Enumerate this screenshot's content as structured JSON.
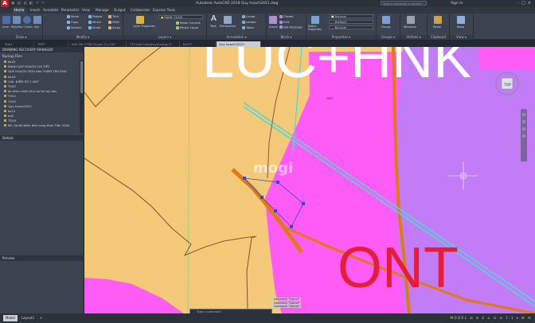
{
  "app": {
    "logo_letter": "A",
    "title": "Autodesk AutoCAD 2018   Quy hoach2021.dwg",
    "search_placeholder": "Type a keyword or phrase",
    "sign_in": "Sign In",
    "quick_access": "▣ ▤ ▥ ◧ ↶ ↷"
  },
  "ribbon_tabs": [
    "Home",
    "Insert",
    "Annotate",
    "Parametric",
    "View",
    "Manage",
    "Output",
    "Collaborate",
    "Express Tools"
  ],
  "ribbon": {
    "draw": {
      "title": "Draw ▾",
      "tools": [
        "Line",
        "Polyline",
        "Circle",
        "Arc"
      ]
    },
    "modify": {
      "title": "Modify ▾",
      "tools": [
        "Move",
        "Rotate",
        "Trim",
        "Copy",
        "Mirror",
        "Fillet",
        "Stretch",
        "Scale",
        "Array"
      ]
    },
    "layers": {
      "title": "Layers ▾",
      "layer_properties": "Layer Properties",
      "current_layer": "RANH_CGCN",
      "make_current": "Make Current",
      "match_layer": "Match Layer"
    },
    "annotation": {
      "title": "Annotation ▾",
      "text": "Text",
      "dimension": "Dimension",
      "linear": "Linear",
      "leader": "Leader",
      "table": "Table"
    },
    "block": {
      "title": "Block ▾",
      "insert": "Insert",
      "create": "Create",
      "edit": "Edit",
      "edit_attributes": "Edit Attributes"
    },
    "properties": {
      "title": "Properties ▾",
      "match": "Match Properties",
      "color": "ByLayer",
      "linetype": "ByBlock",
      "lineweight": "ByLayer"
    },
    "groups": {
      "title": "Groups ▾",
      "group": "Group"
    },
    "utilities": {
      "title": "Utilities ▾",
      "measure": "Measure"
    },
    "clipboard": {
      "title": "Clipboard",
      "paste": "Paste"
    },
    "view": {
      "title": "View ▾",
      "base": "Base"
    }
  },
  "doc_tabs": [
    "Start",
    "TDT*",
    "tinh QH CTXD Huyen Cu Chi*",
    "TTS add tranghuythuong.2*",
    "bc07*",
    "Quy hoach2021*"
  ],
  "palette": {
    "header": "DRAWING RECOVERY MANAGER",
    "backup_title": "Backup Files",
    "files": [
      "bs20",
      "RANH QUY HOACH CHI TIẾT",
      "QUY HOACH 2020 bản THIÊN TRƯỜNG",
      "bs19",
      "14b. ĐIỂM SỐ 2 ANT",
      "TO67",
      "qh dieu chinh khu do thi tay bac",
      "TO41",
      "TO42",
      "Quy hoach2021",
      "bs14",
      "bs6",
      "TO09",
      "86. Sơ đồ điểm đen cong thon Tiền 2004"
    ],
    "details": "Details",
    "preview": "Preview"
  },
  "drawing": {
    "text_top": "LUC+HNK",
    "text_ont": "ONT",
    "small_label": "ONT",
    "watermark": "mogi",
    "colors": {
      "background": "#f5c97a",
      "pink": "#ff5cf5",
      "purple": "#c27cf6",
      "red_text": "#e51c3a",
      "orange": "#e07a12",
      "cyan": "#4fd8d6",
      "selection": "#2b4cd8"
    }
  },
  "command": {
    "history": [
      "Command: *Cancel*",
      "Command: *Cancel*",
      "Command: *Cancel*"
    ],
    "prompt": "Type a command"
  },
  "status": {
    "layouts": [
      "Model",
      "Layout1",
      "+"
    ],
    "right": "MODEL  ⊞ ⊟ ⌗ ∠ ⊡ ⊘  1:1 ▾  ⚙ ☰"
  }
}
